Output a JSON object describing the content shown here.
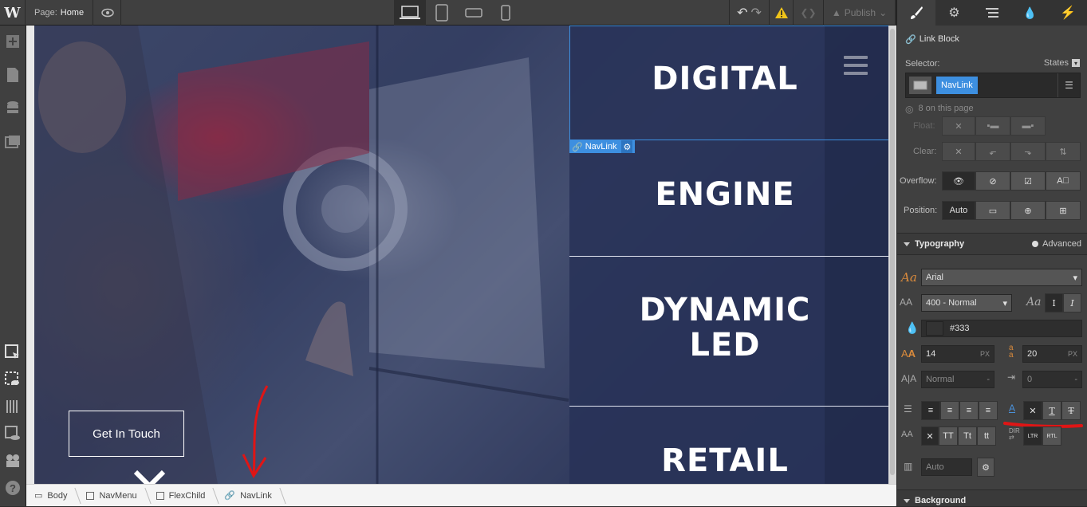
{
  "topbar": {
    "logo": "W",
    "page_prefix": "Page:",
    "page_name": "Home",
    "publish_label": "Publish"
  },
  "canvas": {
    "nav_links": [
      "DIGITAL",
      "ENGINE",
      "DYNAMIC",
      "LED",
      "RETAIL"
    ],
    "selection_tag": "NavLink",
    "cta_button": "Get In Touch"
  },
  "breadcrumb": [
    "Body",
    "NavMenu",
    "FlexChild",
    "NavLink"
  ],
  "panel": {
    "element_type": "Link Block",
    "selector_label": "Selector:",
    "states_label": "States",
    "selector_chip": "NavLink",
    "on_page": "8 on this page",
    "float_label": "Float:",
    "clear_label": "Clear:",
    "overflow_label": "Overflow:",
    "position_label": "Position:",
    "position_auto": "Auto",
    "typography_title": "Typography",
    "advanced_label": "Advanced",
    "font_family": "Arial",
    "font_weight": "400 - Normal",
    "color_value": "#333",
    "font_size": "14",
    "font_size_unit": "PX",
    "line_height": "20",
    "line_height_unit": "PX",
    "letter_spacing": "Normal",
    "text_indent": "0",
    "columns": "Auto",
    "case_buttons": [
      "TT",
      "Tt",
      "tt"
    ],
    "dir_ltr": "LTR",
    "dir_rtl": "RTL",
    "background_title": "Background"
  },
  "colors": {
    "accent_blue": "#3d8fe0",
    "annotation_red": "#e01515",
    "font_icon_orange": "#d98a3c"
  }
}
